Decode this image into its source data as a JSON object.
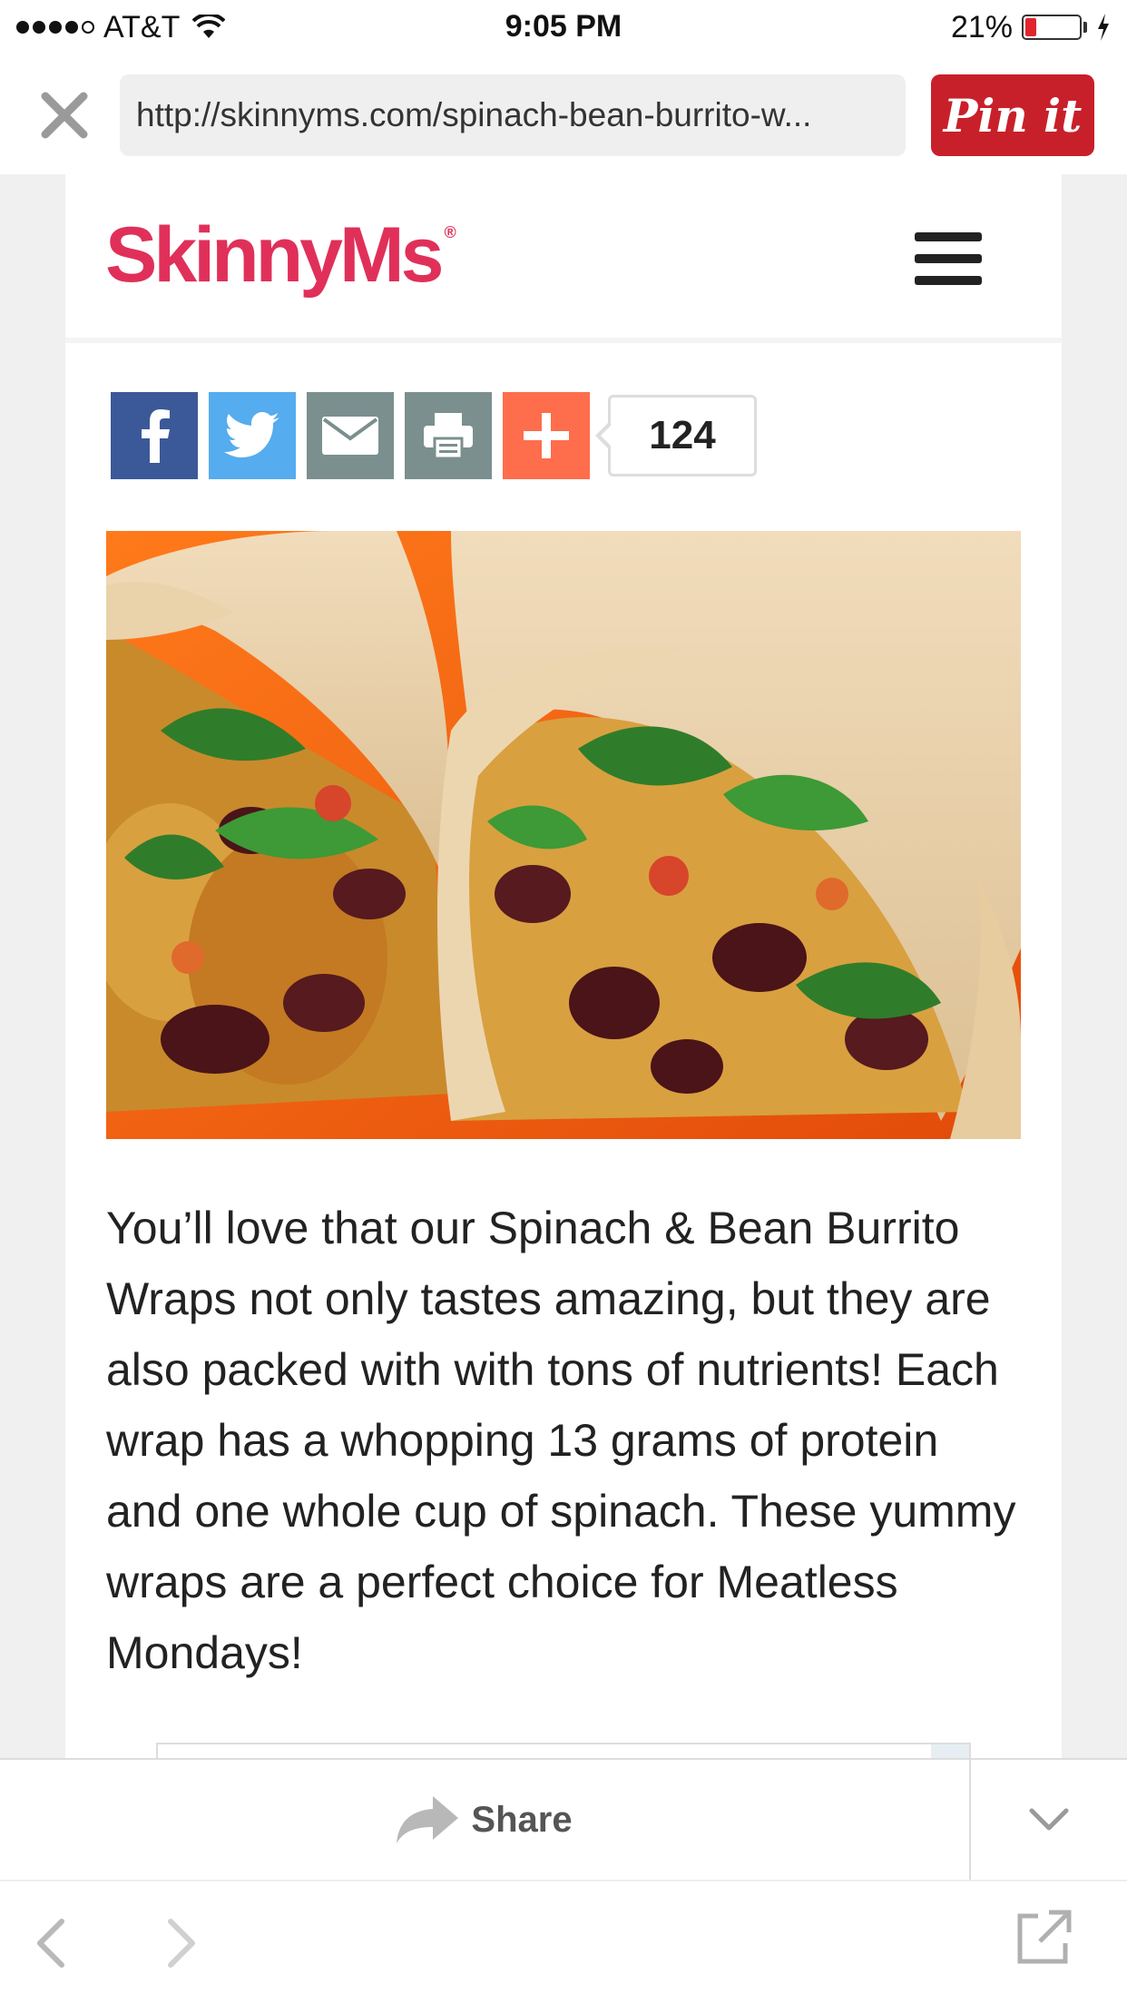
{
  "status_bar": {
    "carrier": "AT&T",
    "time": "9:05 PM",
    "battery_percent": "21%",
    "battery_level": 0.21,
    "signal_bars": 4,
    "signal_max": 5
  },
  "browser": {
    "url": "http://skinnyms.com/spinach-bean-burrito-w...",
    "pin_button_label": "Pin it"
  },
  "site": {
    "logo_text": "SkinnyMs",
    "logo_mark": "®",
    "brand_color": "#e0305a"
  },
  "share_buttons": {
    "items": [
      "facebook-icon",
      "twitter-icon",
      "email-icon",
      "print-icon",
      "add-icon"
    ],
    "count": "124"
  },
  "article": {
    "image_description_icon": "burrito-photo",
    "body": "You’ll love that our Spinach & Bean Burrito Wraps not only tastes amazing, but they are also packed with with tons of nutrients! Each wrap has a whopping 13 grams of protein and one whole cup of spinach. These yummy wraps are a perfect choice for Meatless Mondays!"
  },
  "footer": {
    "share_label": "Share"
  },
  "colors": {
    "pinterest_red": "#c8202a",
    "facebook": "#3b5998",
    "twitter": "#55acee",
    "email": "#7b8f8f",
    "addthis": "#fe6d4c"
  }
}
